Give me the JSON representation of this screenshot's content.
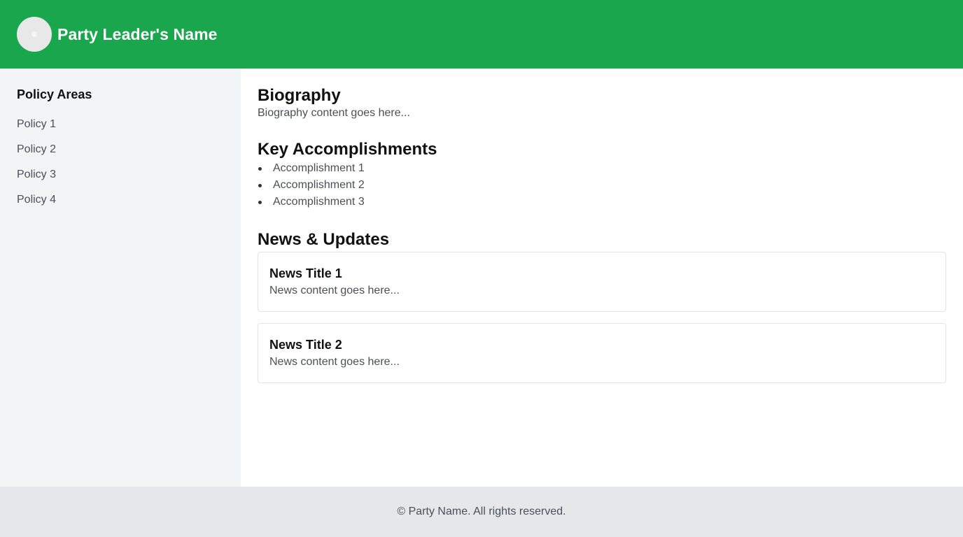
{
  "header": {
    "title": "Party Leader's Name",
    "avatar_icon": "user-avatar-icon",
    "background_color": "#1aa64d"
  },
  "sidebar": {
    "heading": "Policy Areas",
    "items": [
      {
        "label": "Policy 1"
      },
      {
        "label": "Policy 2"
      },
      {
        "label": "Policy 3"
      },
      {
        "label": "Policy 4"
      }
    ]
  },
  "main": {
    "biography": {
      "title": "Biography",
      "text": "Biography content goes here..."
    },
    "accomplishments": {
      "title": "Key Accomplishments",
      "items": [
        "Accomplishment 1",
        "Accomplishment 2",
        "Accomplishment 3"
      ]
    },
    "news": {
      "title": "News & Updates",
      "items": [
        {
          "title": "News Title 1",
          "text": "News content goes here..."
        },
        {
          "title": "News Title 2",
          "text": "News content goes here..."
        }
      ]
    }
  },
  "footer": {
    "text": "© Party Name. All rights reserved."
  }
}
